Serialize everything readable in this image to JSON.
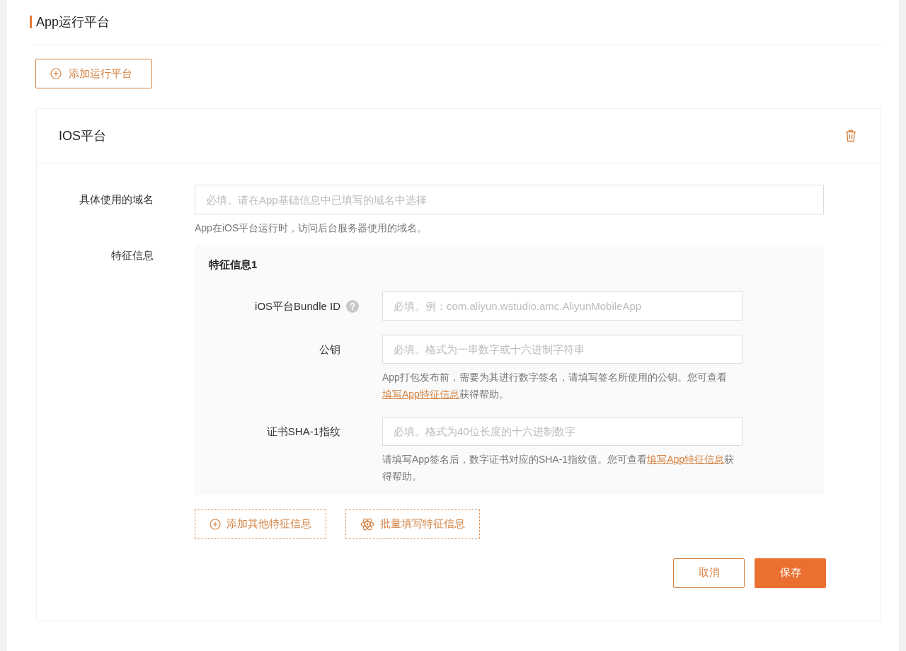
{
  "section": {
    "title": "App运行平台"
  },
  "add_platform_button": {
    "label": "添加运行平台"
  },
  "platform_card": {
    "title": "IOS平台",
    "domain": {
      "label": "具体使用的域名",
      "placeholder": "必填。请在App基础信息中已填写的域名中选择",
      "help": {
        "before": "App在iOS平台运行时，访问后台服务器使用的域名。"
      }
    },
    "features_label": "特征信息",
    "feature_groups": [
      {
        "title": "特征信息1",
        "fields": [
          {
            "label": "iOS平台Bundle ID",
            "has_help_icon": true,
            "placeholder": "必填。例：com.aliyun.wstudio.amc.AliyunMobileApp"
          },
          {
            "label": "公钥",
            "has_help_icon": false,
            "placeholder": "必填。格式为一串数字或十六进制字符串",
            "help": {
              "before": "App打包发布前，需要为其进行数字签名，请填写签名所使用的公钥。您可查看",
              "link": "填写App特征信息",
              "after": "获得帮助。"
            }
          },
          {
            "label": "证书SHA-1指纹",
            "has_help_icon": false,
            "placeholder": "必填。格式为40位长度的十六进制数字",
            "help": {
              "before": "请填写App签名后，数字证书对应的SHA-1指纹值。您可查看",
              "link": "填写App特征信息",
              "after": "获得帮助。"
            }
          }
        ]
      }
    ],
    "feature_buttons": [
      {
        "kind": "add",
        "label": "添加其他特征信息"
      },
      {
        "kind": "batch",
        "label": "批量填写特征信息"
      }
    ],
    "actions": [
      {
        "kind": "secondary",
        "label": "取消"
      },
      {
        "kind": "primary",
        "label": "保存"
      }
    ]
  }
}
